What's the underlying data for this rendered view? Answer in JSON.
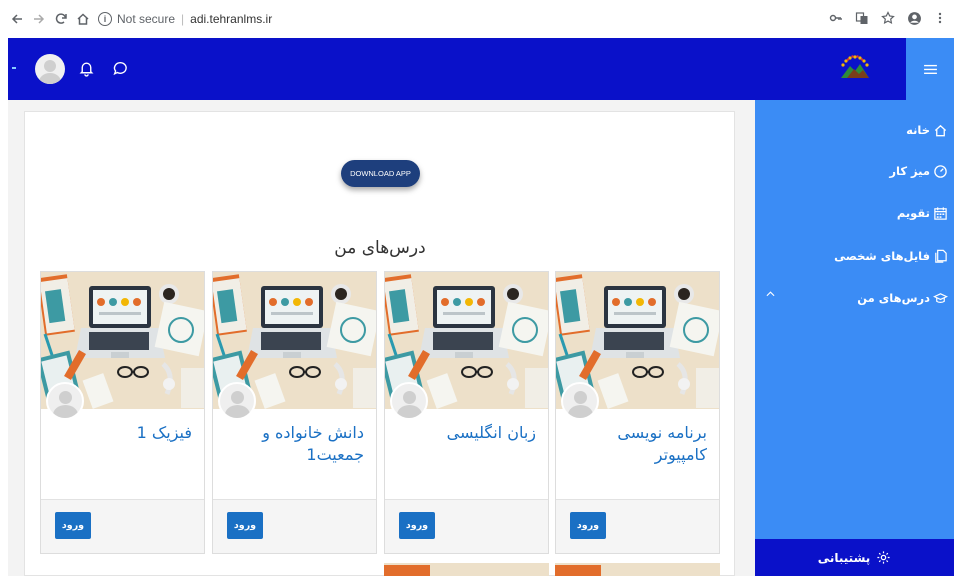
{
  "browser": {
    "secure_label": "Not secure",
    "url": "adi.tehranlms.ir"
  },
  "sidebar": {
    "items": [
      {
        "label": "خانه",
        "icon": "home-icon"
      },
      {
        "label": "میز کار",
        "icon": "dashboard-icon"
      },
      {
        "label": "تقویم",
        "icon": "calendar-icon"
      },
      {
        "label": "فایل‌های شخصی",
        "icon": "files-icon"
      },
      {
        "label": "درس‌های من",
        "icon": "graduation-cap-icon"
      }
    ],
    "footer_label": "پشتیبانی"
  },
  "main": {
    "download_button": "DOWNLOAD APP",
    "section_title": "درس‌های من",
    "courses": [
      {
        "title": "برنامه نویسی کامپیوتر",
        "enter_label": "ورود"
      },
      {
        "title": "زبان انگلیسی",
        "enter_label": "ورود"
      },
      {
        "title": "دانش خانواده و جمعیت1",
        "enter_label": "ورود"
      },
      {
        "title": "فیزیک 1",
        "enter_label": "ورود"
      }
    ]
  },
  "colors": {
    "navbar": "#0a11c9",
    "sidebar": "#3b8cf5",
    "link": "#1a70c4",
    "button": "#1a70c4"
  }
}
